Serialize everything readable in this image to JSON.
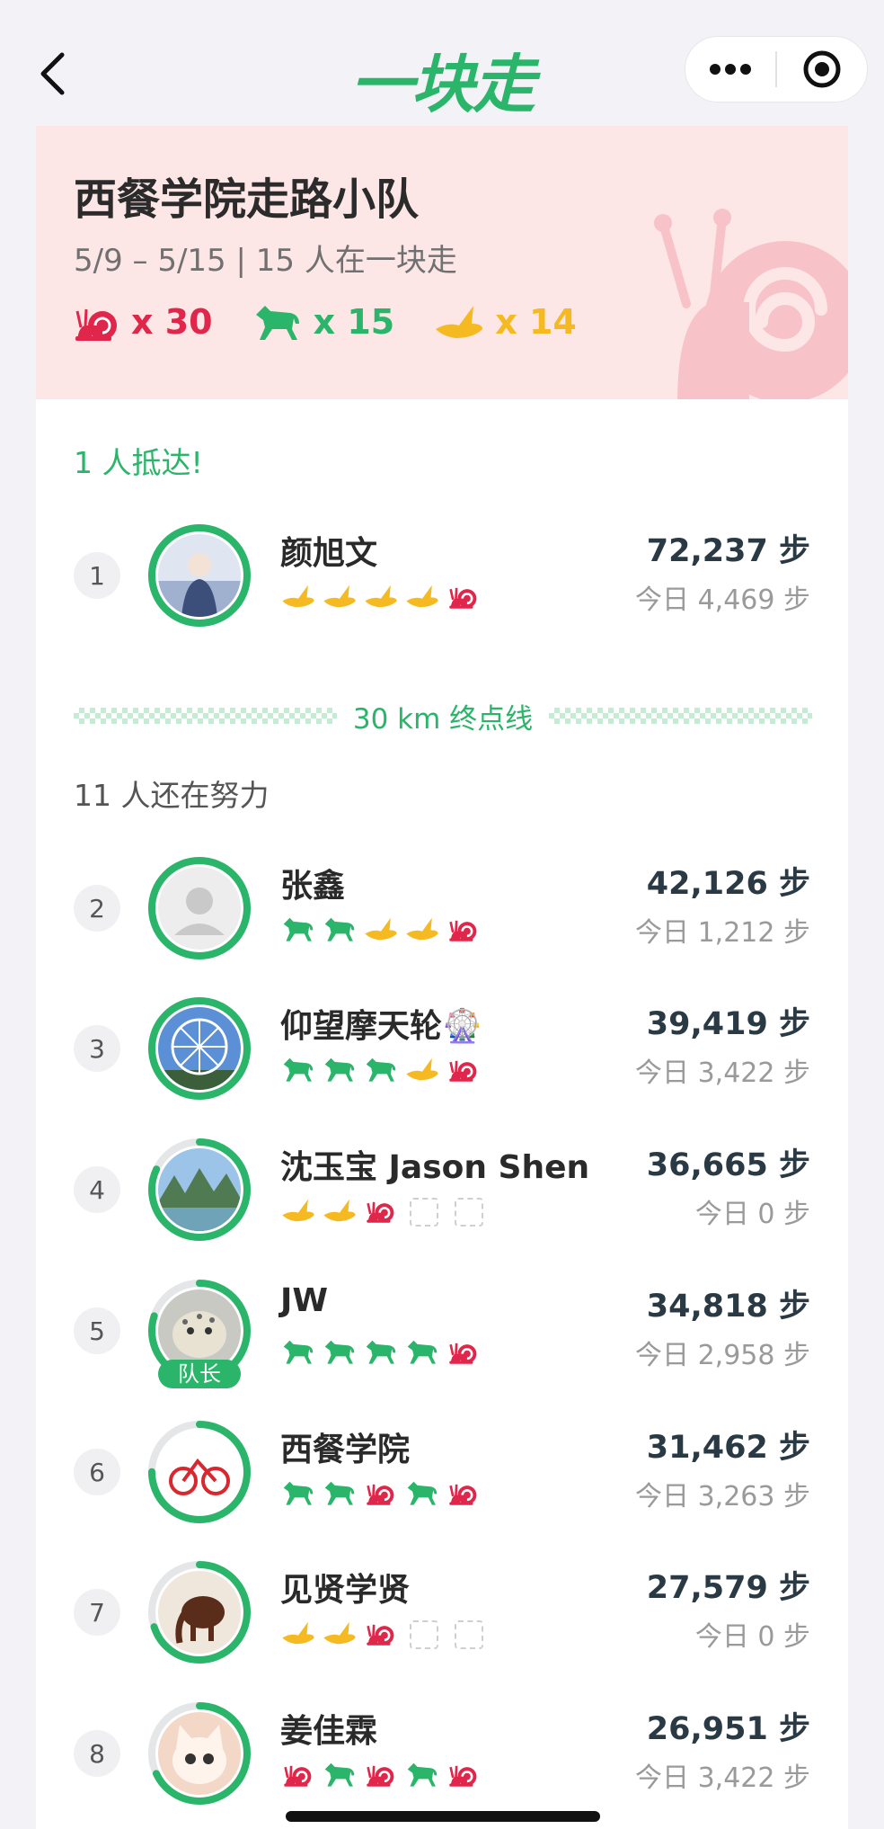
{
  "nav": {
    "title": "一块走",
    "back_icon": "chevron-left-icon",
    "more_icon": "more-icon",
    "close_icon": "target-icon"
  },
  "team": {
    "name": "西餐学院走路小队",
    "subtitle": "5/9 – 5/15 | 15 人在一块走",
    "counts": [
      {
        "icon": "snail-icon",
        "label": "x 30",
        "color": "#e0264a"
      },
      {
        "icon": "horse-icon",
        "label": "x 15",
        "color": "#2bb56a"
      },
      {
        "icon": "bird-icon",
        "label": "x 14",
        "color": "#f5b921"
      }
    ]
  },
  "arrived_label": "1 人抵达!",
  "finish_label": "30 km 终点线",
  "striving_label": "11 人还在努力",
  "members": [
    {
      "rank": "1",
      "name": "颜旭文",
      "steps": "72,237 步",
      "today": "今日 4,469 步",
      "progress": 1.0,
      "badges": [
        "bird",
        "bird",
        "bird",
        "bird",
        "snail"
      ],
      "captain": false,
      "avatar": "portrait"
    },
    {
      "rank": "2",
      "name": "张鑫",
      "steps": "42,126 步",
      "today": "今日 1,212 步",
      "progress": 1.0,
      "badges": [
        "horse",
        "horse",
        "bird",
        "bird",
        "snail"
      ],
      "captain": false,
      "avatar": "default"
    },
    {
      "rank": "3",
      "name": "仰望摩天轮🎡",
      "steps": "39,419 步",
      "today": "今日 3,422 步",
      "progress": 1.0,
      "badges": [
        "horse",
        "horse",
        "horse",
        "bird",
        "snail"
      ],
      "captain": false,
      "avatar": "ferris"
    },
    {
      "rank": "4",
      "name": "沈玉宝 Jason Shen",
      "steps": "36,665 步",
      "today": "今日 0 步",
      "progress": 0.82,
      "badges": [
        "bird",
        "bird",
        "snail",
        "empty",
        "empty"
      ],
      "captain": false,
      "avatar": "landscape"
    },
    {
      "rank": "5",
      "name": "JW",
      "steps": "34,818 步",
      "today": "今日 2,958 步",
      "progress": 0.8,
      "badges": [
        "horse",
        "horse",
        "horse",
        "horse",
        "snail"
      ],
      "captain": true,
      "captain_label": "队长",
      "avatar": "leopard"
    },
    {
      "rank": "6",
      "name": "西餐学院",
      "steps": "31,462 步",
      "today": "今日 3,263 步",
      "progress": 0.75,
      "badges": [
        "horse",
        "horse",
        "snail",
        "horse",
        "snail"
      ],
      "captain": false,
      "avatar": "bike"
    },
    {
      "rank": "7",
      "name": "见贤学贤",
      "steps": "27,579 步",
      "today": "今日 0 步",
      "progress": 0.7,
      "badges": [
        "bird",
        "bird",
        "snail",
        "empty",
        "empty"
      ],
      "captain": false,
      "avatar": "elephant"
    },
    {
      "rank": "8",
      "name": "姜佳霖",
      "steps": "26,951 步",
      "today": "今日 3,422 步",
      "progress": 0.68,
      "badges": [
        "snail",
        "horse",
        "snail",
        "horse",
        "snail"
      ],
      "captain": false,
      "avatar": "cat"
    }
  ],
  "colors": {
    "green": "#2bb56a",
    "snail_red": "#e0264a",
    "bird_yellow": "#f5b921",
    "banner_pink": "#fde6e6"
  }
}
